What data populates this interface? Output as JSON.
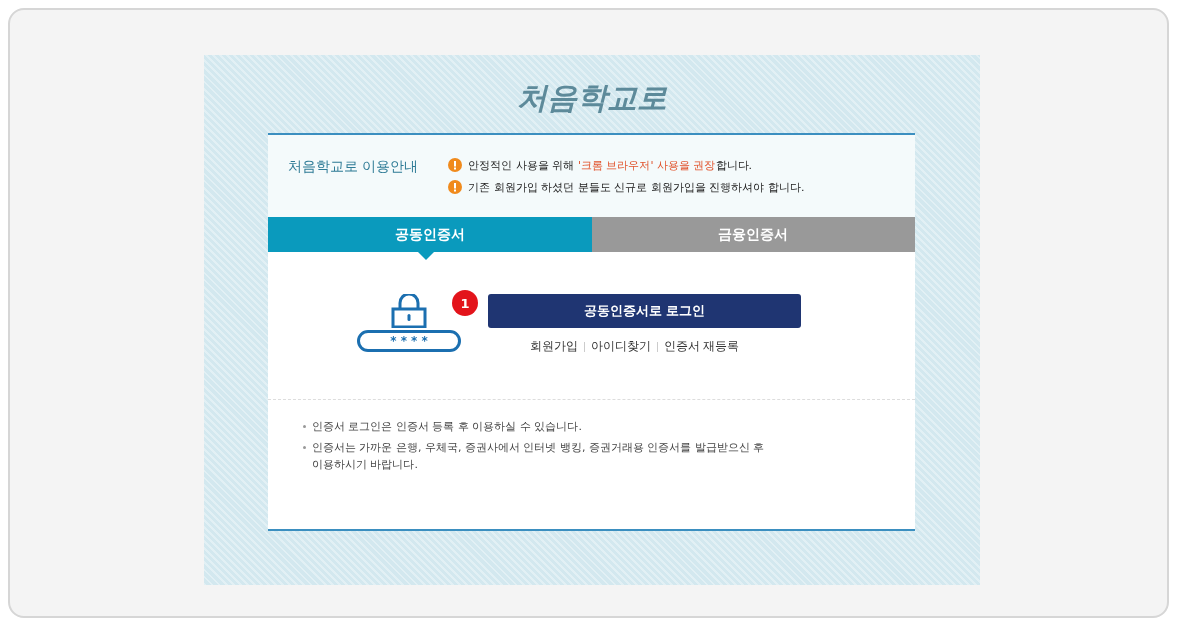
{
  "logo": {
    "text": "처음학교로"
  },
  "notice": {
    "title": "처음학교로 이용안내",
    "items": [
      {
        "parts": [
          {
            "text": "안정적인 사용을 위해 ",
            "highlight": false
          },
          {
            "text": "'크롬 브라우저' 사용을 권장",
            "highlight": true
          },
          {
            "text": "합니다.",
            "highlight": false
          }
        ]
      },
      {
        "parts": [
          {
            "text": "기존 회원가입 하셨던 분들도 신규로 회원가입을 진행하셔야 합니다.",
            "highlight": false
          }
        ]
      }
    ]
  },
  "tabs": [
    {
      "label": "공동인증서",
      "selected": true
    },
    {
      "label": "금융인증서",
      "selected": false
    }
  ],
  "login": {
    "step_badge": "1",
    "button": "공동인증서로 로그인",
    "password_mask": "* * * *",
    "links": [
      "회원가입",
      "아이디찾기",
      "인증서 재등록"
    ]
  },
  "notes": [
    "인증서 로그인은 인증서 등록 후 이용하실 수 있습니다.",
    "인증서는 가까운 은행, 우체국, 증권사에서 인터넷 뱅킹, 증권거래용 인증서를 발급받으신 후 이용하시기 바랍니다."
  ]
}
